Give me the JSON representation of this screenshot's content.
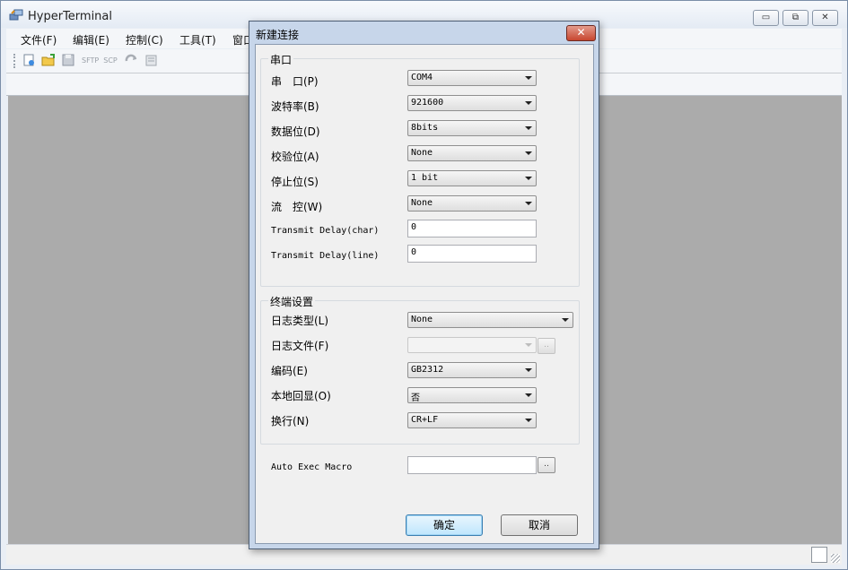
{
  "app": {
    "title": "HyperTerminal"
  },
  "window_controls": {
    "minimize": "▭",
    "maximize": "⧉",
    "close": "✕"
  },
  "menu": [
    {
      "label": "文件(F)"
    },
    {
      "label": "编辑(E)"
    },
    {
      "label": "控制(C)"
    },
    {
      "label": "工具(T)"
    },
    {
      "label": "窗口"
    }
  ],
  "toolbar": {
    "icons": [
      "new-icon",
      "open-icon",
      "save-icon",
      "sftp-icon",
      "scp-icon",
      "reconnect-icon",
      "properties-icon"
    ],
    "sftp_label": "SFTP",
    "scp_label": "SCP"
  },
  "dialog": {
    "title": "新建连接",
    "close_glyph": "✕",
    "serial_group": {
      "title": "串口",
      "port": {
        "label": "串　口(P)",
        "value": "COM4"
      },
      "baud": {
        "label": "波特率(B)",
        "value": "921600"
      },
      "databits": {
        "label": "数据位(D)",
        "value": "8bits"
      },
      "parity": {
        "label": "校验位(A)",
        "value": "None"
      },
      "stopbits": {
        "label": "停止位(S)",
        "value": "1 bit"
      },
      "flow": {
        "label": "流　控(W)",
        "value": "None"
      },
      "delay_char": {
        "label": "Transmit Delay(char)",
        "value": "0"
      },
      "delay_line": {
        "label": "Transmit Delay(line)",
        "value": "0"
      }
    },
    "terminal_group": {
      "title": "终端设置",
      "log_type": {
        "label": "日志类型(L)",
        "value": "None"
      },
      "log_file": {
        "label": "日志文件(F)",
        "value": ""
      },
      "encoding": {
        "label": "编码(E)",
        "value": "GB2312"
      },
      "local_echo": {
        "label": "本地回显(O)",
        "value": "否"
      },
      "newline": {
        "label": "换行(N)",
        "value": "CR+LF"
      }
    },
    "auto_exec": {
      "label": "Auto Exec Macro",
      "value": ""
    },
    "browse_label": "..",
    "ok_label": "确定",
    "cancel_label": "取消"
  },
  "colors": {
    "workspace": "#ababab",
    "dialog_frame": "#c7d6ea",
    "close_red": "#c7462f"
  }
}
